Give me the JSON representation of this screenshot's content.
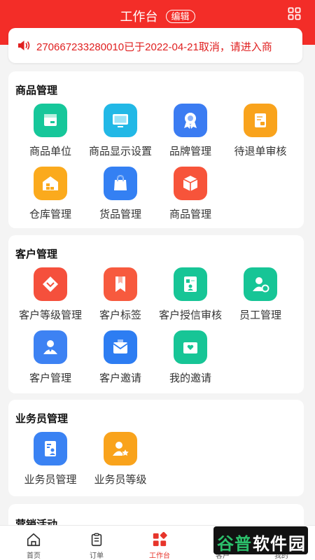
{
  "header": {
    "title": "工作台",
    "edit_label": "编辑"
  },
  "notice": {
    "text": "270667233280010已于2022-04-21取消，请进入商"
  },
  "sections": {
    "goods": {
      "title": "商品管理",
      "items": [
        {
          "label": "商品单位",
          "icon": "box-icon",
          "color": "#16c79a"
        },
        {
          "label": "商品显示设置",
          "icon": "monitor-icon",
          "color": "#22b8e6"
        },
        {
          "label": "品牌管理",
          "icon": "badge-icon",
          "color": "#3b7cf2"
        },
        {
          "label": "待退单审核",
          "icon": "invoice-icon",
          "color": "#f9a31c"
        },
        {
          "label": "仓库管理",
          "icon": "warehouse-icon",
          "color": "#fbaa1d"
        },
        {
          "label": "货品管理",
          "icon": "shopping-bag-icon",
          "color": "#3480f3"
        },
        {
          "label": "商品管理",
          "icon": "cube-icon",
          "color": "#f7543a"
        }
      ]
    },
    "customer": {
      "title": "客户管理",
      "items": [
        {
          "label": "客户等级管理",
          "icon": "diamond-icon",
          "color": "#f5503c"
        },
        {
          "label": "客户标签",
          "icon": "bookmark-icon",
          "color": "#f75a3e"
        },
        {
          "label": "客户授信审核",
          "icon": "id-card-icon",
          "color": "#17c596"
        },
        {
          "label": "员工管理",
          "icon": "user-gear-icon",
          "color": "#17c596"
        },
        {
          "label": "客户管理",
          "icon": "users-icon",
          "color": "#3d82f3"
        },
        {
          "label": "客户邀请",
          "icon": "mail-icon",
          "color": "#2d7df2"
        },
        {
          "label": "我的邀请",
          "icon": "heart-mail-icon",
          "color": "#17c596"
        }
      ]
    },
    "salesman": {
      "title": "业务员管理",
      "items": [
        {
          "label": "业务员管理",
          "icon": "profile-doc-icon",
          "color": "#3a82f3"
        },
        {
          "label": "业务员等级",
          "icon": "user-star-icon",
          "color": "#f9a31c"
        }
      ]
    },
    "marketing": {
      "title": "营销活动"
    }
  },
  "tabbar": {
    "items": [
      {
        "label": "首页",
        "icon": "home-icon"
      },
      {
        "label": "订单",
        "icon": "clipboard-icon"
      },
      {
        "label": "工作台",
        "icon": "workbench-icon",
        "active": true
      },
      {
        "label": "客户",
        "icon": "user-icon"
      },
      {
        "label": "我的",
        "icon": "profile-icon"
      }
    ]
  },
  "watermark": {
    "chars": [
      "谷",
      "普",
      "软",
      "件",
      "园"
    ]
  },
  "colors": {
    "brand": "#f32d28",
    "notice_text": "#e02020",
    "tab_active": "#e7352b"
  }
}
